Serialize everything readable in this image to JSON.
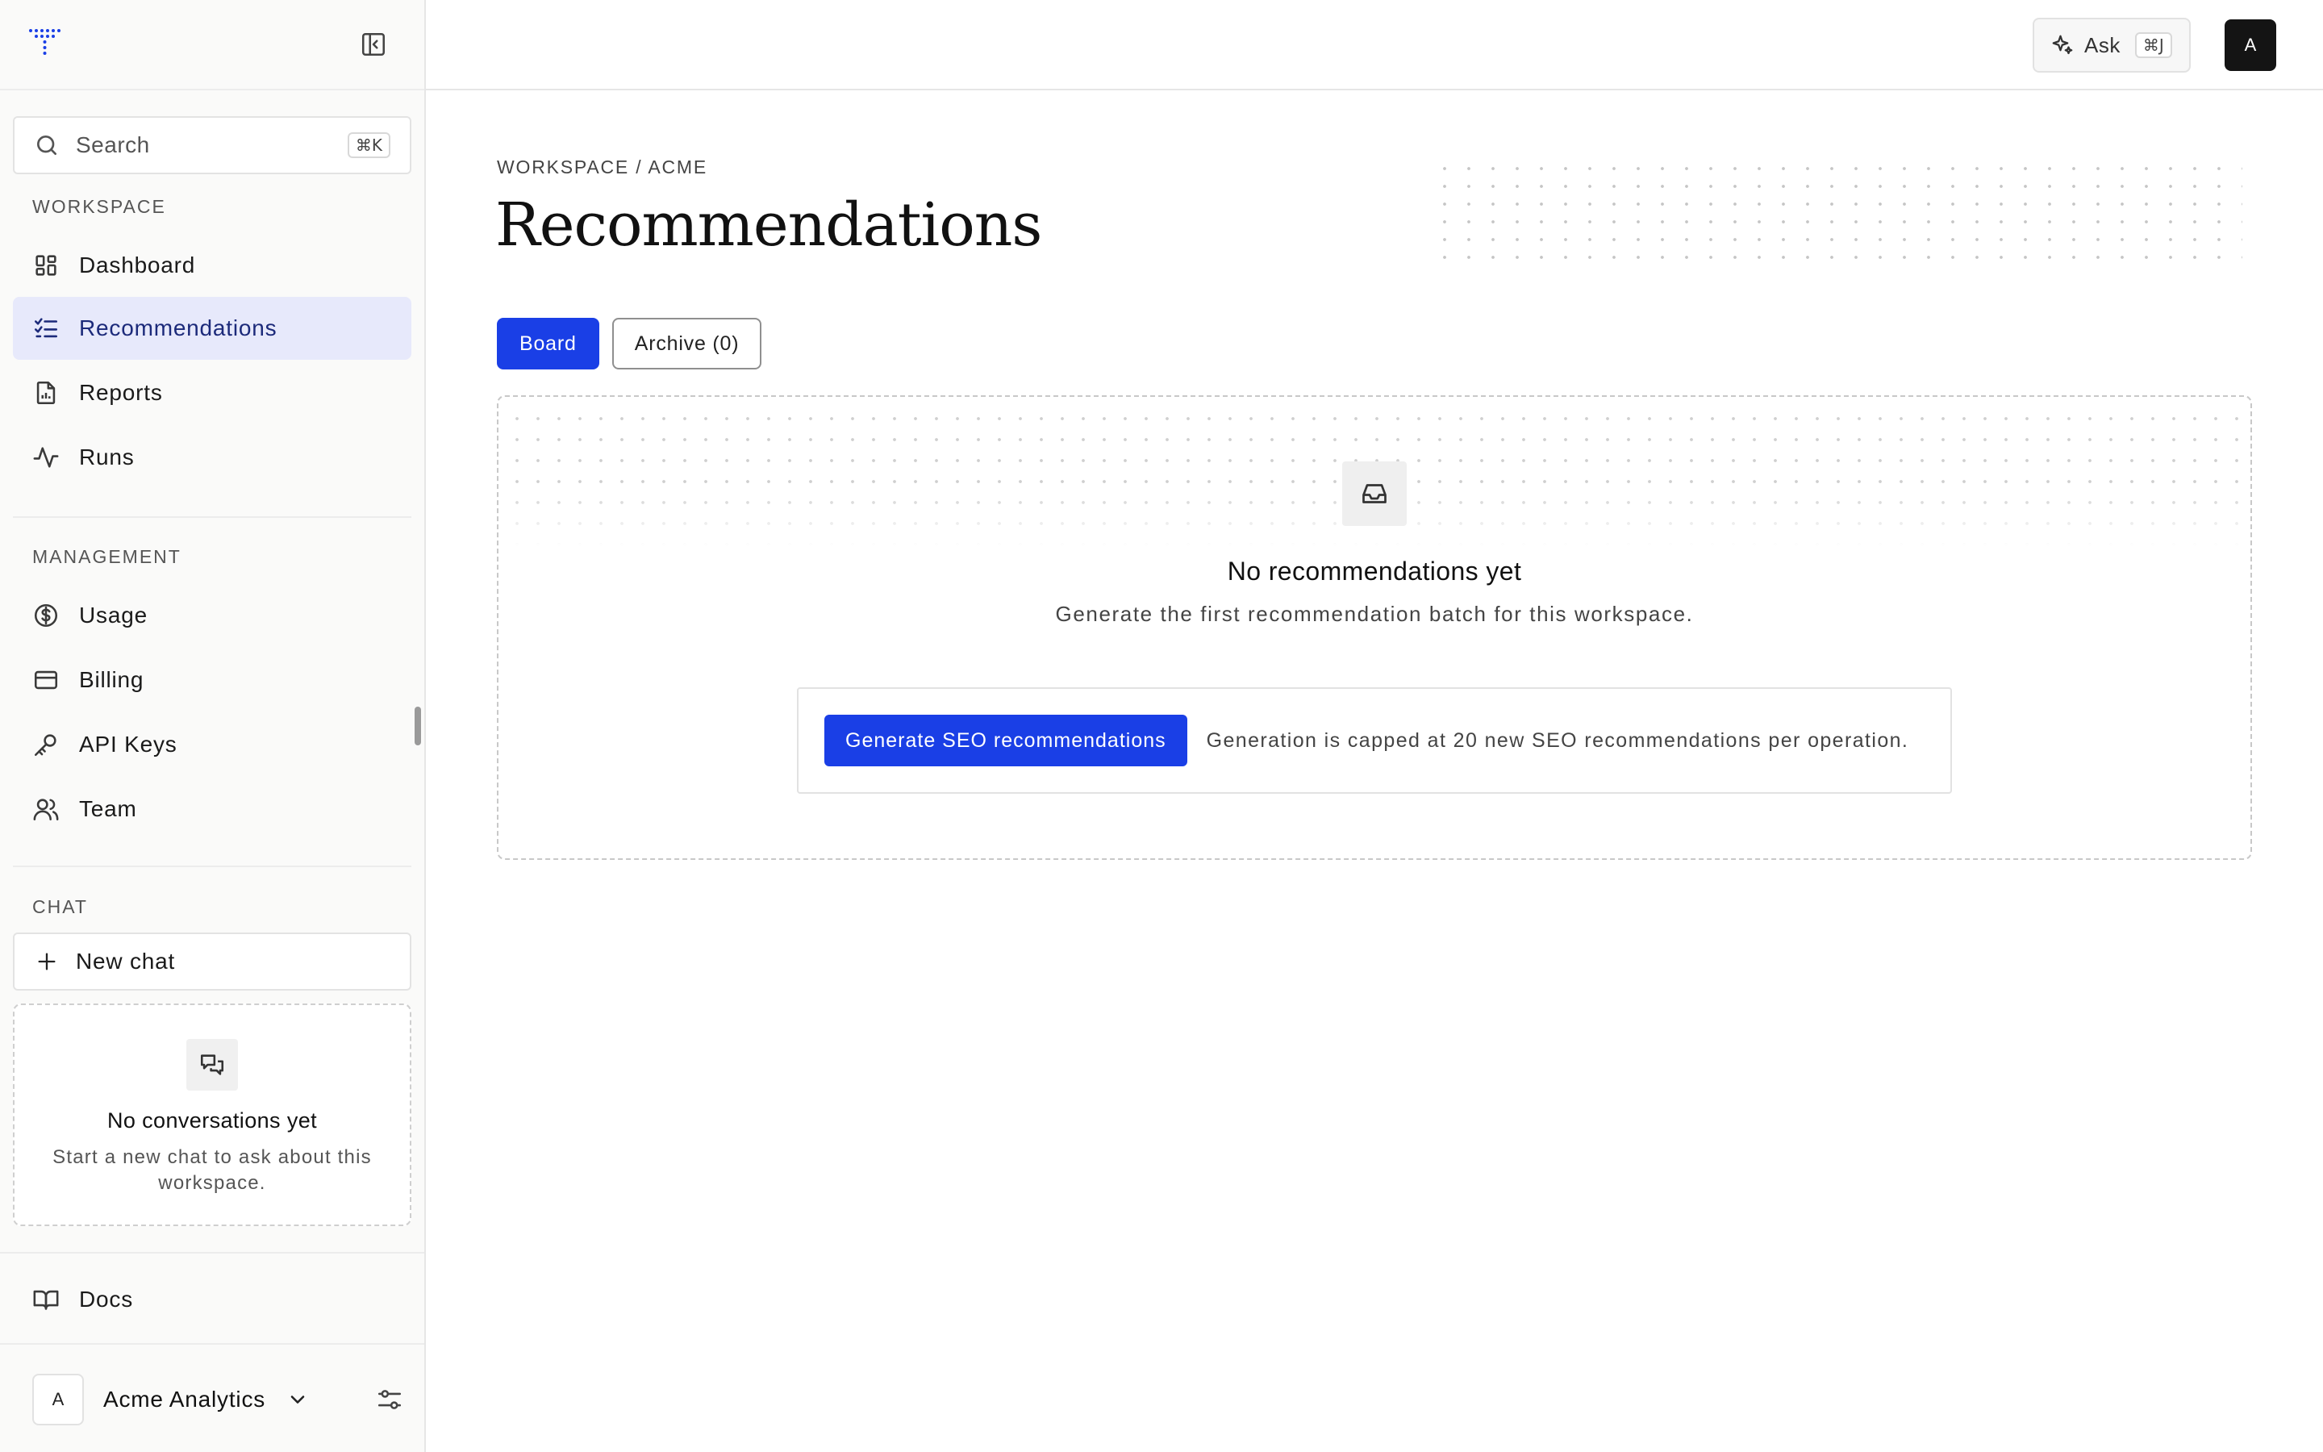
{
  "sidebar": {
    "search": {
      "placeholder": "Search",
      "shortcut": "⌘K"
    },
    "sections": {
      "workspace": "WORKSPACE",
      "management": "MANAGEMENT",
      "chat": "CHAT"
    },
    "workspace_items": [
      {
        "label": "Dashboard",
        "icon": "grid-icon",
        "active": false
      },
      {
        "label": "Recommendations",
        "icon": "checklist-icon",
        "active": true
      },
      {
        "label": "Reports",
        "icon": "report-file-icon",
        "active": false
      },
      {
        "label": "Runs",
        "icon": "activity-icon",
        "active": false
      }
    ],
    "management_items": [
      {
        "label": "Usage",
        "icon": "dollar-circle-icon"
      },
      {
        "label": "Billing",
        "icon": "credit-card-icon"
      },
      {
        "label": "API Keys",
        "icon": "key-icon"
      },
      {
        "label": "Team",
        "icon": "users-icon"
      }
    ],
    "new_chat_label": "New chat",
    "conversations_empty": {
      "title": "No conversations yet",
      "text": "Start a new chat to ask about this workspace."
    },
    "docs_label": "Docs",
    "account": {
      "avatar": "A",
      "name": "Acme Analytics"
    }
  },
  "topbar": {
    "ask_label": "Ask",
    "ask_shortcut": "⌘J",
    "user_avatar": "A"
  },
  "main": {
    "breadcrumb": "WORKSPACE / ACME",
    "title": "Recommendations",
    "tabs": [
      {
        "label": "Board",
        "active": true
      },
      {
        "label": "Archive (0)",
        "active": false
      }
    ],
    "empty_state": {
      "title": "No recommendations yet",
      "subtitle": "Generate the first recommendation batch for this workspace.",
      "generate_button": "Generate SEO recommendations",
      "generate_note": "Generation is capped at 20 new SEO recommendations per operation."
    }
  },
  "colors": {
    "accent": "#1a3fe6",
    "active_nav_bg": "#e7e9fb",
    "active_nav_text": "#1c2a7a",
    "sidebar_bg": "#fafaf9"
  }
}
